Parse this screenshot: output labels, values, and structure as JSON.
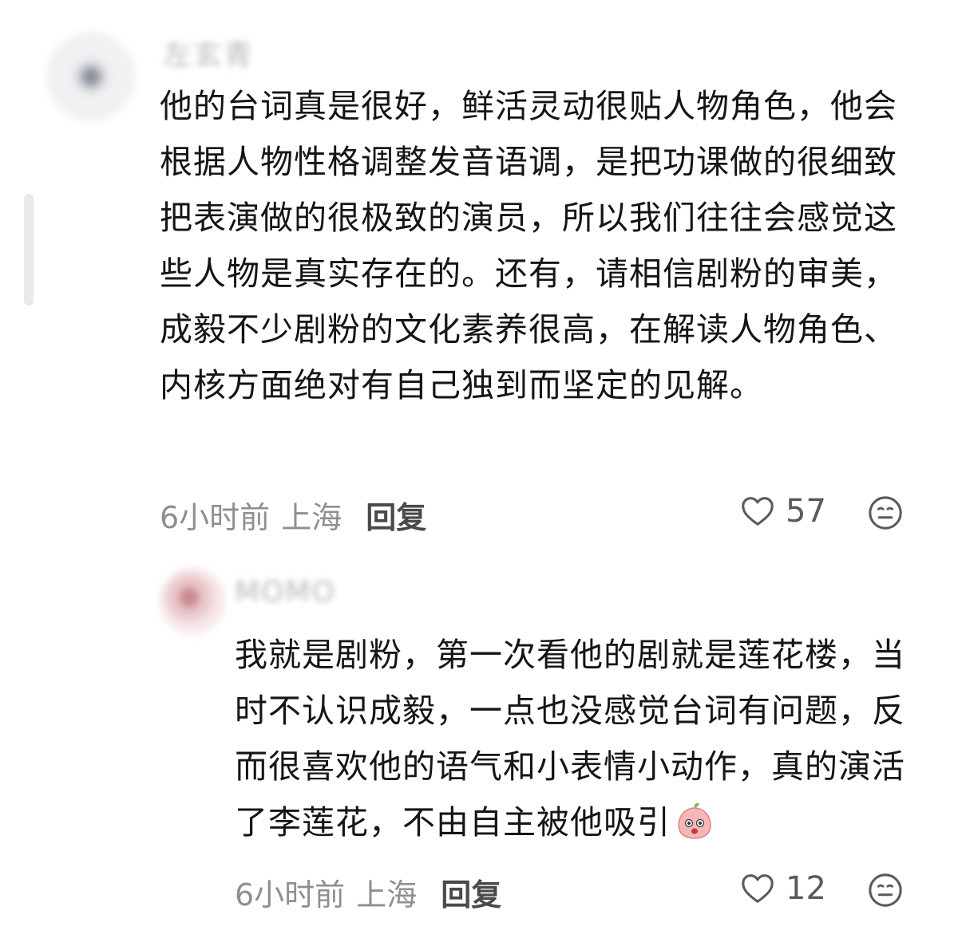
{
  "comments": [
    {
      "username": "左玄青",
      "text": "他的台词真是很好，鲜活灵动很贴人物角色，他会根据人物性格调整发音语调，是把功课做的很细致把表演做的很极致的演员，所以我们往往会感觉这些人物是真实存在的。还有，请相信剧粉的审美，成毅不少剧粉的文化素养很高，在解读人物角色、内核方面绝对有自己独到而坚定的见解。",
      "time": "6小时前",
      "location": "上海",
      "reply_label": "回复",
      "likes": "57"
    },
    {
      "username": "MOMO",
      "text": "我就是剧粉，第一次看他的剧就是莲花楼，当时不认识成毅，一点也没感觉台词有问题，反而很喜欢他的语气和小表情小动作，真的演活了李莲花，不由自主被他吸引",
      "time": "6小时前",
      "location": "上海",
      "reply_label": "回复",
      "likes": "12",
      "sticker": "peach-face-sticker"
    }
  ],
  "icons": {
    "like": "heart-outline-icon",
    "emoji": "neutral-face-icon"
  },
  "colors": {
    "text": "#151515",
    "meta": "#8f8f8f",
    "reply": "#4a4a4a"
  }
}
